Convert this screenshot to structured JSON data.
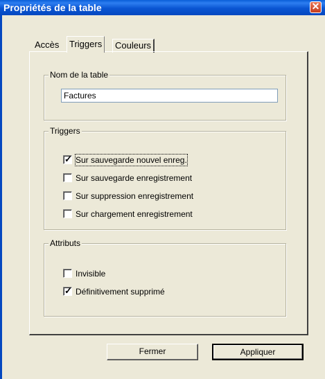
{
  "window": {
    "title": "Propriétés de la table",
    "close_symbol": "✕"
  },
  "tabs": [
    {
      "label": "Accès"
    },
    {
      "label": "Triggers",
      "selected": true
    },
    {
      "label": "Couleurs"
    }
  ],
  "name_group": {
    "legend": "Nom de la table",
    "value": "Factures"
  },
  "triggers_group": {
    "legend": "Triggers",
    "items": [
      {
        "label": "Sur sauvegarde nouvel enreg.",
        "checked": true
      },
      {
        "label": "Sur sauvegarde enregistrement",
        "checked": false
      },
      {
        "label": "Sur suppression enregistrement",
        "checked": false
      },
      {
        "label": "Sur chargement enregistrement",
        "checked": false
      }
    ]
  },
  "attributes_group": {
    "legend": "Attributs",
    "items": [
      {
        "label": "Invisible",
        "checked": false
      },
      {
        "label": "Définitivement supprimé",
        "checked": true
      }
    ]
  },
  "buttons": {
    "close_label": "Fermer",
    "apply_label": "Appliquer"
  },
  "check_mark": "✓"
}
